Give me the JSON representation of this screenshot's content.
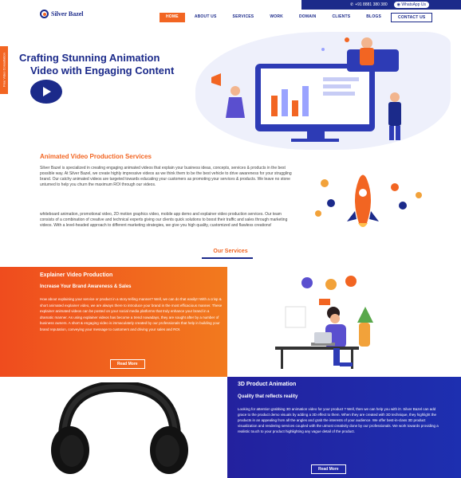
{
  "topbar": {
    "phone": "+91 8881 380 380",
    "whatsapp": "WhatsApp Us"
  },
  "logo": {
    "name": "Silver Bazel"
  },
  "nav": {
    "items": [
      "HOME",
      "ABOUT US",
      "SERVICES",
      "WORK",
      "DOMAIN",
      "CLIENTS",
      "BLOGS",
      "CONTACT US"
    ]
  },
  "side_tab": "Free Video Consultation",
  "hero": {
    "title_line1": "Crafting Stunning Animation",
    "title_line2": "Video with Engaging Content"
  },
  "intro": {
    "title": "Animated Video Production Services",
    "para1": "Silver Bazel is specialized in creating engaging animated videos that explain your business ideas, concepts, services & products in the best possible way. At Silver Bazel, we create highly impressive videos as we think them to be the best vehicle to drive awareness for your struggling brand. Our catchy animated videos are targeted towards educating your customers as promoting your services & products. We leave no stone unturned to help you churn the maximum ROI through our videos.",
    "para2": "whiteboard animation, promotional video, 2D motion graphics video, mobile app demo and explainer video production services. Our team consists of a combination of creative and technical experts giving our clients quick solutions to boost their traffic and sales through marketing videos. With a level-headed approach to different marketing strategies, we give you high quality, customized and flawless creations!"
  },
  "services": {
    "title": "Our Services"
  },
  "explainer": {
    "title": "Explainer Video Production",
    "subtitle": "Increase Your Brand Awareness & Sales",
    "body": "How about explaining your service or product in a story-telling manner? Well, we can do that easily!! With a crisp & short animated explainer video, we are always there to introduce your brand in the most efficacious manner. These explainer animated videos can be posted on your social media platforms that truly enhance your brand in a dramatic manner. As using explainer videos has become a trend nowadays, they are sought after by a number of business owners. A short & engaging video is immaculately created by our professionals that help in building your brand reputation, conveying your message to customers and driving your sales and ROI.",
    "button": "Read More"
  },
  "product3d": {
    "title": "3D Product Animation",
    "subtitle": "Quality that reflects reality",
    "body": "Looking for attention grabbing 3D animation video for your product ? Well, then we can help you with it!. Silver Bazel can add grace to the product demo visuals by adding a 3D effect to them. When they are created with 3D technique, they highlight the products in an appealing from all the angles and grab the interests of your audience. We offer best-in-class 3D product visualization and rendering services coupled with the utmost creativity done by our professionals. We work towards providing a realistic touch to your product highlighting any vague detail of the product.",
    "button": "Read More"
  },
  "colors": {
    "brand_blue": "#1b2a8a",
    "accent_orange": "#f26522"
  }
}
